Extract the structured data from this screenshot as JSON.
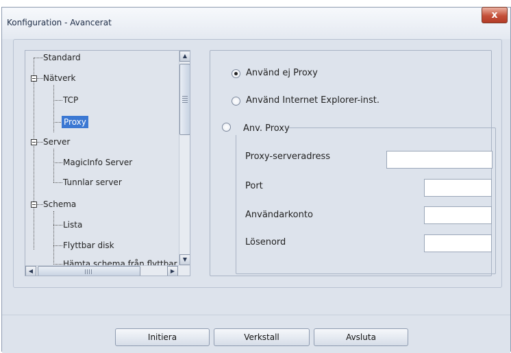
{
  "window": {
    "title": "Konfiguration - Avancerat",
    "close_label": "x"
  },
  "tree": {
    "nodes": [
      {
        "label": "Standard"
      },
      {
        "label": "Nätverk"
      },
      {
        "label": "TCP"
      },
      {
        "label": "Proxy",
        "selected": true
      },
      {
        "label": "Server"
      },
      {
        "label": "MagicInfo Server"
      },
      {
        "label": "Tunnlar server"
      },
      {
        "label": "Schema"
      },
      {
        "label": "Lista"
      },
      {
        "label": "Flyttbar disk"
      },
      {
        "label": "Hämta schema från flyttbar"
      }
    ]
  },
  "proxy": {
    "options": [
      {
        "label": "Använd  ej Proxy",
        "checked": true
      },
      {
        "label": "Använd Internet Explorer-inst.",
        "checked": false
      },
      {
        "label": "Anv. Proxy",
        "checked": false
      }
    ],
    "fields": [
      {
        "label": "Proxy-serveradress",
        "value": ""
      },
      {
        "label": "Port",
        "value": ""
      },
      {
        "label": "Användarkonto",
        "value": ""
      },
      {
        "label": "Lösenord",
        "value": ""
      }
    ]
  },
  "buttons": {
    "initiera": "Initiera",
    "verkstall": "Verkstall",
    "avsluta": "Avsluta"
  }
}
